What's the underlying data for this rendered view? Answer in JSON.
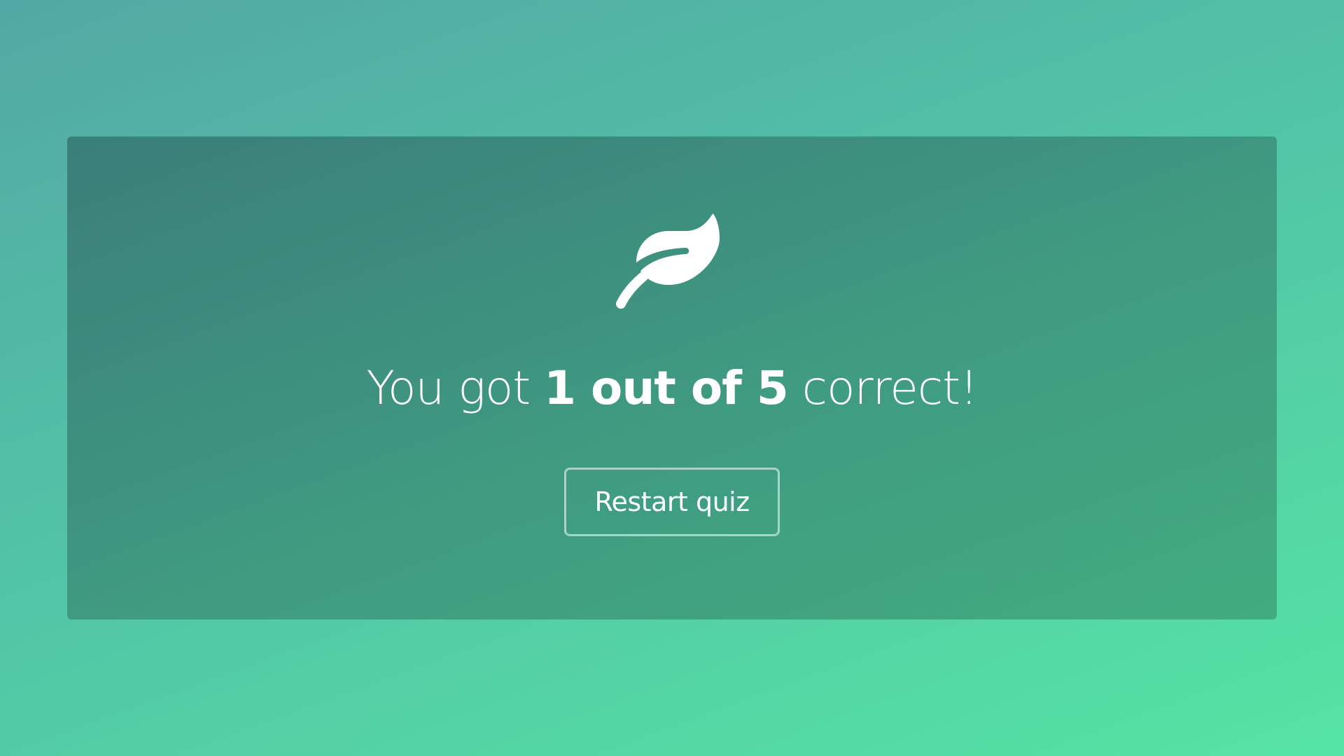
{
  "results": {
    "icon": "leaf-icon",
    "score_prefix": "You got ",
    "score_strong": "1 out of 5",
    "score_suffix": " correct!",
    "restart_label": "Restart quiz"
  },
  "colors": {
    "background_start": "#52a8a4",
    "background_end": "#55e4a3",
    "card": "#3a8a74",
    "text": "#ffffff"
  }
}
